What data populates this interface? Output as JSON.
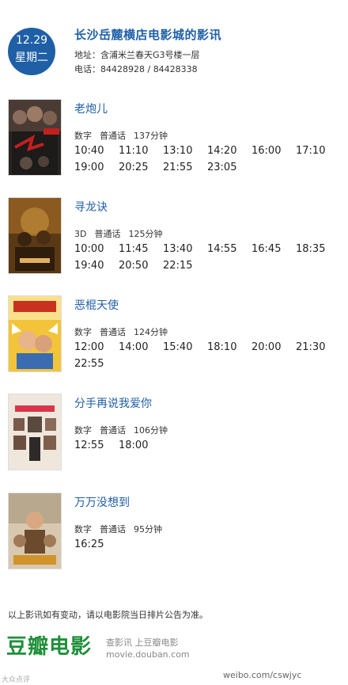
{
  "header": {
    "date": "12.29",
    "weekday": "星期二",
    "cinema": "长沙岳麓横店电影城的影讯",
    "address_label": "地址：",
    "address": "含浦米兰春天G3号楼一层",
    "phone_label": "电话：",
    "phone": "84428928 / 84428338"
  },
  "movies": [
    {
      "title": "老炮儿",
      "format": "数字",
      "language": "普通话",
      "duration": "137分钟",
      "times": [
        "10:40",
        "11:10",
        "13:10",
        "14:20",
        "16:00",
        "17:10",
        "19:00",
        "20:25",
        "21:55",
        "23:05"
      ]
    },
    {
      "title": "寻龙诀",
      "format": "3D",
      "language": "普通话",
      "duration": "125分钟",
      "times": [
        "10:00",
        "11:45",
        "13:40",
        "14:55",
        "16:45",
        "18:35",
        "19:40",
        "20:50",
        "22:15"
      ]
    },
    {
      "title": "恶棍天使",
      "format": "数字",
      "language": "普通话",
      "duration": "124分钟",
      "times": [
        "12:00",
        "14:00",
        "15:40",
        "18:10",
        "20:00",
        "21:30",
        "22:55"
      ]
    },
    {
      "title": "分手再说我爱你",
      "format": "数字",
      "language": "普通话",
      "duration": "106分钟",
      "times": [
        "12:55",
        "18:00"
      ]
    },
    {
      "title": "万万没想到",
      "format": "数字",
      "language": "普通话",
      "duration": "95分钟",
      "times": [
        "16:25"
      ]
    }
  ],
  "note": "以上影讯如有变动，请以电影院当日排片公告为准。",
  "footer": {
    "logo": "豆瓣电影",
    "tag1": "查影讯  上豆瓣电影",
    "tag2": "movie.douban.com",
    "watermark_left": "大众点评",
    "watermark_right": "weibo.com/cswjyc"
  },
  "colors": {
    "accent": "#1f5fa6",
    "logo_green": "#1f8f3a"
  }
}
